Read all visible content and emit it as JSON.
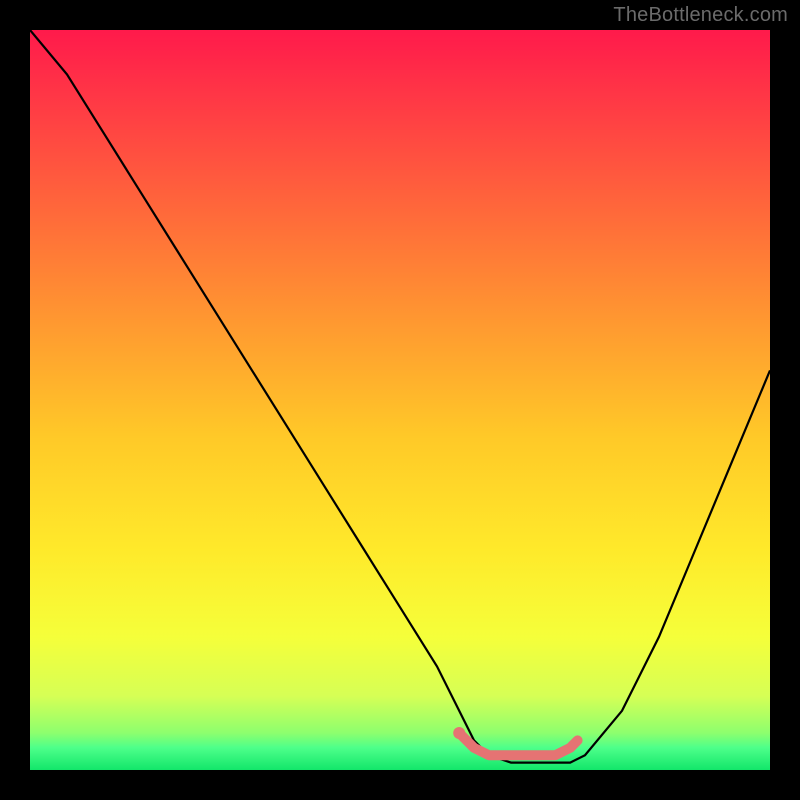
{
  "watermark": "TheBottleneck.com",
  "chart_data": {
    "type": "line",
    "title": "",
    "xlabel": "",
    "ylabel": "",
    "xlim": [
      0,
      100
    ],
    "ylim": [
      0,
      100
    ],
    "grid": false,
    "legend": false,
    "series": [
      {
        "name": "bottleneck-curve",
        "color": "#000000",
        "x": [
          0,
          5,
          10,
          15,
          20,
          25,
          30,
          35,
          40,
          45,
          50,
          55,
          58,
          60,
          62,
          65,
          70,
          73,
          75,
          80,
          85,
          90,
          95,
          100
        ],
        "y": [
          100,
          94,
          86,
          78,
          70,
          62,
          54,
          46,
          38,
          30,
          22,
          14,
          8,
          4,
          2,
          1,
          1,
          1,
          2,
          8,
          18,
          30,
          42,
          54
        ]
      },
      {
        "name": "optimal-range-marker",
        "color": "#e57373",
        "x": [
          58,
          60,
          62,
          65,
          68,
          71,
          73,
          74
        ],
        "y": [
          5,
          3,
          2,
          2,
          2,
          2,
          3,
          4
        ]
      }
    ],
    "markers": [
      {
        "name": "optimal-start-dot",
        "x": 58,
        "y": 5,
        "color": "#e57373"
      }
    ],
    "gradient_stops": [
      {
        "offset": 0.0,
        "color": "#ff1a4b"
      },
      {
        "offset": 0.1,
        "color": "#ff3a45"
      },
      {
        "offset": 0.25,
        "color": "#ff6a3a"
      },
      {
        "offset": 0.4,
        "color": "#ff9a30"
      },
      {
        "offset": 0.55,
        "color": "#ffc928"
      },
      {
        "offset": 0.7,
        "color": "#ffe92a"
      },
      {
        "offset": 0.82,
        "color": "#f5ff3a"
      },
      {
        "offset": 0.9,
        "color": "#d6ff55"
      },
      {
        "offset": 0.95,
        "color": "#8dff6e"
      },
      {
        "offset": 0.97,
        "color": "#4dff8a"
      },
      {
        "offset": 1.0,
        "color": "#12e66a"
      }
    ]
  }
}
